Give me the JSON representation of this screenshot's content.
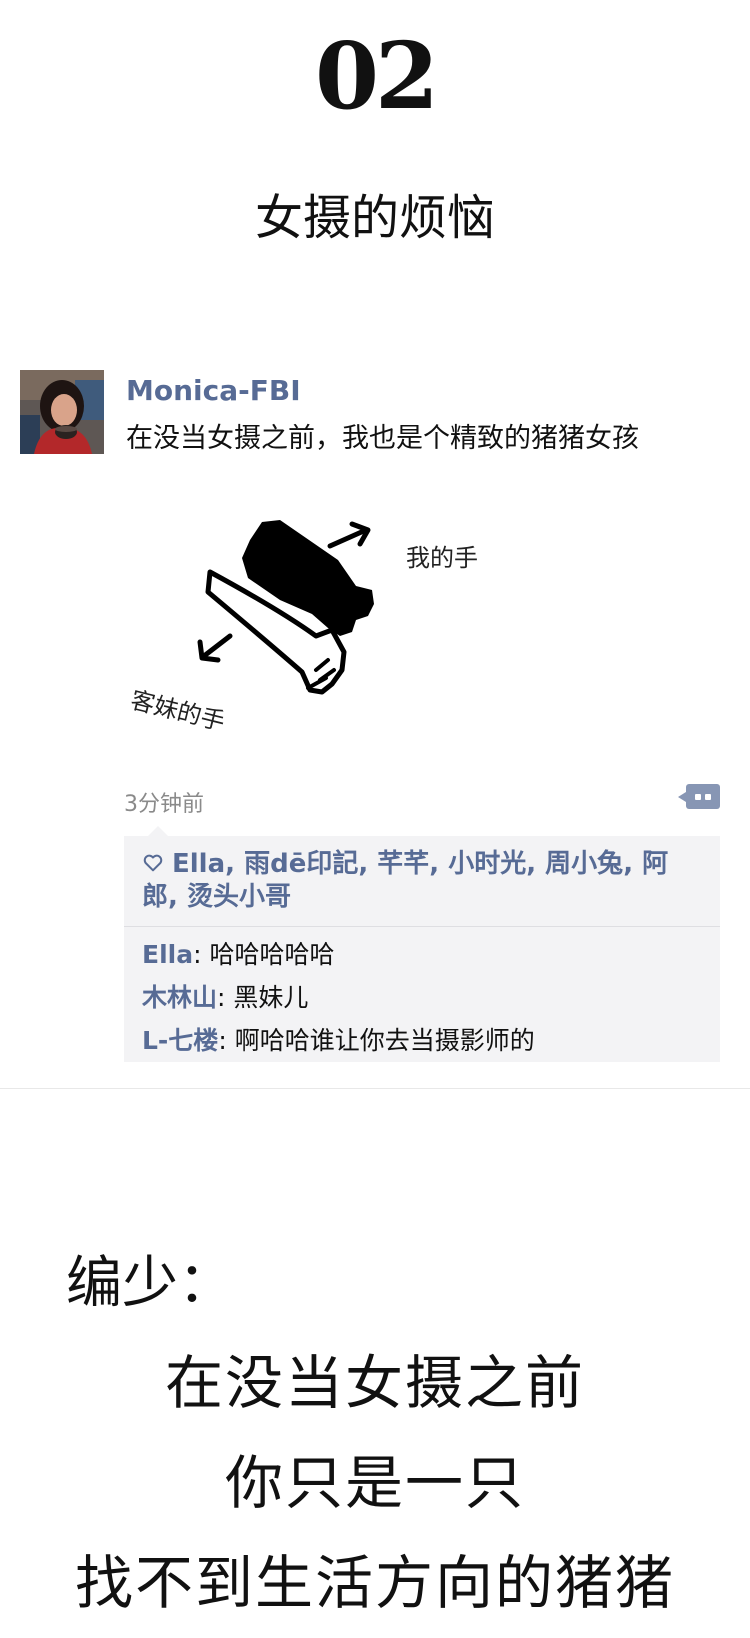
{
  "header": {
    "number": "02",
    "title": "女摄的烦恼"
  },
  "post": {
    "username": "Monica-FBI",
    "text": "在没当女摄之前，我也是个精致的猪猪女孩",
    "image_labels": {
      "mine": "我的手",
      "client": "客妹的手"
    },
    "time": "3分钟前",
    "likes": [
      "Ella",
      "雨dē印記",
      "芊芊",
      "小时光",
      "周小兔",
      "阿郎",
      "烫头小哥"
    ],
    "comments": [
      {
        "name": "Ella",
        "text": "哈哈哈哈哈"
      },
      {
        "name": "木林山",
        "text": "黑妹儿"
      },
      {
        "name": "L-七楼",
        "text": "啊哈哈谁让你去当摄影师的"
      }
    ]
  },
  "caption": {
    "editor": "编少：",
    "lines": [
      "在没当女摄之前",
      "你只是一只",
      "找不到生活方向的猪猪"
    ]
  },
  "colors": {
    "link": "#576b95",
    "panel": "#f3f3f5",
    "comment_button": "#8796b4"
  },
  "icons": [
    "heart-icon",
    "comment-icon"
  ]
}
